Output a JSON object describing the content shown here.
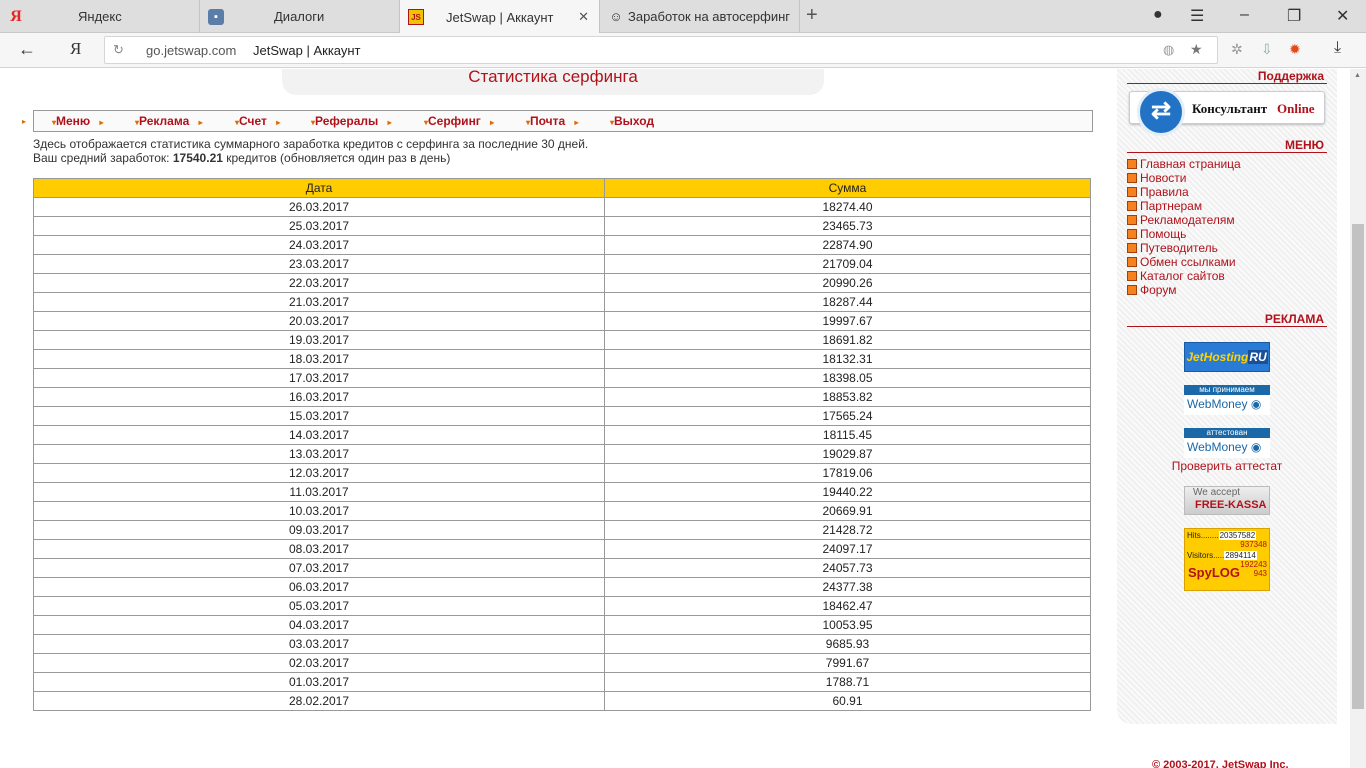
{
  "browser": {
    "tabs": [
      {
        "title": "Яндекс",
        "icon": "yandex-icon"
      },
      {
        "title": "Диалоги",
        "icon": "dialogs-icon"
      },
      {
        "title": "JetSwap | Аккаунт",
        "icon": "jetswap-icon"
      },
      {
        "title": "Заработок на автосерфинг",
        "icon": "surf-icon"
      }
    ],
    "url_domain": "go.jetswap.com",
    "page_title": "JetSwap | Аккаунт"
  },
  "header": {
    "title": "Статистика серфинга"
  },
  "menu": [
    "Меню",
    "Реклама",
    "Счет",
    "Рефералы",
    "Серфинг",
    "Почта",
    "Выход"
  ],
  "description": {
    "line1": "Здесь отображается статистика суммарного заработка кредитов с серфинга за последние 30 дней.",
    "line2_prefix": "Ваш средний заработок: ",
    "avg_value": "17540.21",
    "line2_suffix": " кредитов (обновляется один раз в день)"
  },
  "table": {
    "headers": [
      "Дата",
      "Сумма"
    ],
    "rows": [
      [
        "26.03.2017",
        "18274.40"
      ],
      [
        "25.03.2017",
        "23465.73"
      ],
      [
        "24.03.2017",
        "22874.90"
      ],
      [
        "23.03.2017",
        "21709.04"
      ],
      [
        "22.03.2017",
        "20990.26"
      ],
      [
        "21.03.2017",
        "18287.44"
      ],
      [
        "20.03.2017",
        "19997.67"
      ],
      [
        "19.03.2017",
        "18691.82"
      ],
      [
        "18.03.2017",
        "18132.31"
      ],
      [
        "17.03.2017",
        "18398.05"
      ],
      [
        "16.03.2017",
        "18853.82"
      ],
      [
        "15.03.2017",
        "17565.24"
      ],
      [
        "14.03.2017",
        "18115.45"
      ],
      [
        "13.03.2017",
        "19029.87"
      ],
      [
        "12.03.2017",
        "17819.06"
      ],
      [
        "11.03.2017",
        "19440.22"
      ],
      [
        "10.03.2017",
        "20669.91"
      ],
      [
        "09.03.2017",
        "21428.72"
      ],
      [
        "08.03.2017",
        "24097.17"
      ],
      [
        "07.03.2017",
        "24057.73"
      ],
      [
        "06.03.2017",
        "24377.38"
      ],
      [
        "05.03.2017",
        "18462.47"
      ],
      [
        "04.03.2017",
        "10053.95"
      ],
      [
        "03.03.2017",
        "9685.93"
      ],
      [
        "02.03.2017",
        "7991.67"
      ],
      [
        "01.03.2017",
        "1788.71"
      ],
      [
        "28.02.2017",
        "60.91"
      ]
    ]
  },
  "sidebar": {
    "support_label": "Поддержка",
    "consultant_label": "Консультант",
    "consultant_online": "Online",
    "menu_label": "МЕНЮ",
    "menu_items": [
      "Главная страница",
      "Новости",
      "Правила",
      "Партнерам",
      "Рекламодателям",
      "Помощь",
      "Путеводитель",
      "Обмен ссылками",
      "Каталог сайтов",
      "Форум"
    ],
    "ads_label": "РЕКЛАМА",
    "jethosting": "JetHosting",
    "jethosting_ru": "RU",
    "wm_accept_top": "мы принимаем",
    "wm_name": "WebMoney",
    "wm_attest_top": "аттестован",
    "verify_attest": "Проверить аттестат",
    "freekassa_top": "We accept",
    "freekassa_name": "FREE-KASSA",
    "splog_hits_label": "Hits",
    "splog_hits": "20357582",
    "splog_hits2": "937348",
    "splog_visitors_label": "Visitors",
    "splog_visitors": "2894114",
    "splog_visitors2": "192243",
    "splog_visitors3": "943",
    "splog_logo": "SpyLOG"
  },
  "footer": "© 2003-2017, JetSwap Inc."
}
